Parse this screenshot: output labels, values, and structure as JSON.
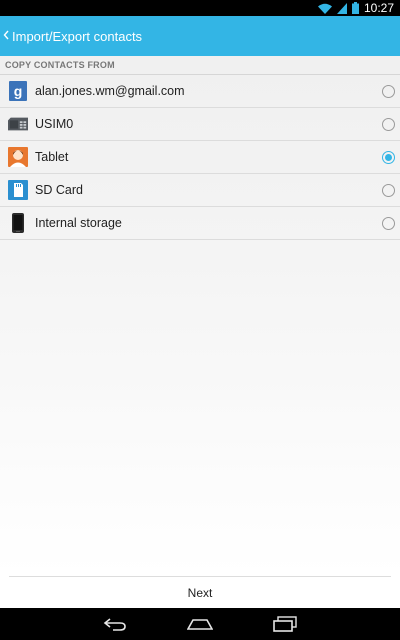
{
  "status_bar": {
    "time": "10:27",
    "icons": [
      "wifi-icon",
      "signal-icon",
      "battery-icon"
    ]
  },
  "action_bar": {
    "title": "Import/Export contacts",
    "up_icon": "chevron-left-icon"
  },
  "section": {
    "header": "COPY CONTACTS FROM"
  },
  "sources": [
    {
      "label": "alan.jones.wm@gmail.com",
      "icon": "google-account-icon",
      "selected": false
    },
    {
      "label": "USIM0",
      "icon": "sim-card-icon",
      "selected": false
    },
    {
      "label": "Tablet",
      "icon": "tablet-contact-icon",
      "selected": true
    },
    {
      "label": "SD Card",
      "icon": "sd-card-icon",
      "selected": false
    },
    {
      "label": "Internal storage",
      "icon": "phone-storage-icon",
      "selected": false
    }
  ],
  "footer": {
    "next_label": "Next"
  },
  "nav_bar": {
    "icons": [
      "back-icon",
      "home-icon",
      "recents-icon"
    ]
  },
  "colors": {
    "accent": "#33b5e5",
    "google_blue": "#3b73b9",
    "tablet_orange": "#e8772e",
    "sd_blue": "#2a8fd0"
  }
}
